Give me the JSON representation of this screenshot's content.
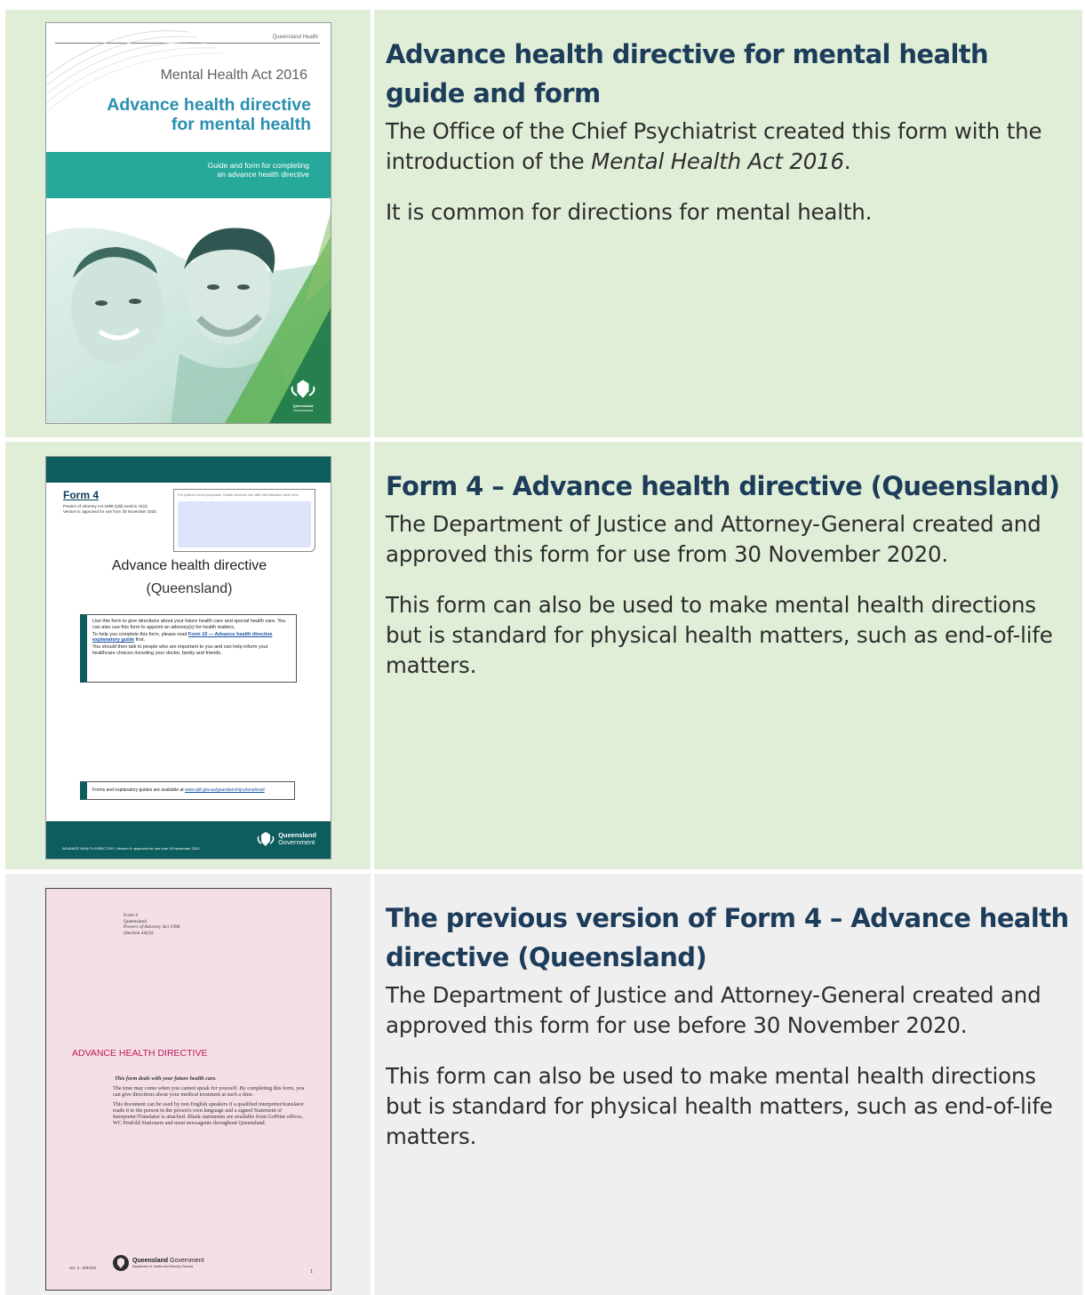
{
  "rows": [
    {
      "heading": "Advance health directive for mental health guide and form",
      "paragraph1_prefix": "The Office of the Chief Psychiatrist created this form with the introduction of the ",
      "paragraph1_italic": "Mental Health Act 2016",
      "paragraph1_suffix": ".",
      "paragraph2": "It is common for directions for mental health.",
      "thumbnail": {
        "header": "Queensland Health",
        "act": "Mental Health Act 2016",
        "title_line1": "Advance health directive",
        "title_line2": "for mental health",
        "subtitle_line1": "Guide and form for completing",
        "subtitle_line2": "an advance health directive",
        "crest_text_line1": "Queensland",
        "crest_text_line2": "Government"
      }
    },
    {
      "heading": "Form 4 – Advance health directive (Queensland)",
      "paragraph1": "The Department of Justice and Attorney-General created and approved this form for use from 30 November 2020.",
      "paragraph2": "This form can also be used to make mental health directions but is standard for physical health matters, such as end-of-life matters.",
      "thumbnail": {
        "form_label": "Form 4",
        "meta_line1": "Powers of Attorney Act 1998 (Qld) section 44(2)",
        "meta_line2": "Version 5: approved for use from 30 November 2020.",
        "id_box_label": "For patient record purposes, health services can affix identification label here",
        "title": "Advance health directive",
        "subtitle": "(Queensland)",
        "info_p1": "Use this form to give directions about your future health care and special health care. You can also use this form to appoint an attorney(s) for health matters.",
        "info_p2_prefix": "To help you complete this form, please read ",
        "info_p2_link": "Form 10 — Advance health directive explanatory guide",
        "info_p2_suffix": " first.",
        "info_p3": "You should then talk to people who are important to you and can help inform your healthcare choices including your doctor, family and friends.",
        "links_prefix": "Forms and explanatory guides are available at ",
        "links_url": "www.qld.gov.au/guardianship-planahead",
        "footer": "ADVANCE HEALTH DIRECTIVE  |  Version 5: approved for use from 30 November 2020.",
        "gov_line1": "Queensland",
        "gov_line2": "Government"
      }
    },
    {
      "heading": "The previous version of Form 4 – Advance health directive (Queensland)",
      "paragraph1": "The Department of Justice and Attorney-General created and approved this form for use before 30 November 2020.",
      "paragraph2": "This form can also be used to make mental health directions but is standard for physical health matters, such as end-of-life matters.",
      "thumbnail": {
        "meta_line1": "Form 4",
        "meta_line2": "Queensland",
        "meta_line3": "Powers of Attorney Act 1998",
        "meta_line4": "(Section 44(2))",
        "title": "ADVANCE HEALTH DIRECTIVE",
        "lead": "This form deals with your future health care.",
        "body_p1": "The time may come when you cannot speak for yourself. By completing this form, you can give directions about your medical treatment at such a time.",
        "body_p2": "This document can be used by non English speakers if a qualified interpreter/translator reads it to the person in the person's own language and a signed Statement of Interpreter/Translator is attached. Blank statements are available from GoPrint offices, WC Penfold Stationers and most newsagents throughout Queensland.",
        "version": "ver. 4 - 6/01/04",
        "gov_bold": "Queensland",
        "gov_normal": " Government",
        "dept": "Department of Justice and Attorney-General",
        "page_number": "1"
      }
    }
  ],
  "colors": {
    "green_row": "#e1eed7",
    "grey_row": "#efefef",
    "heading": "#1c3c5a",
    "body_text": "#2d2d2d",
    "teal": "#0d5c5e",
    "magenta": "#c1185a"
  }
}
